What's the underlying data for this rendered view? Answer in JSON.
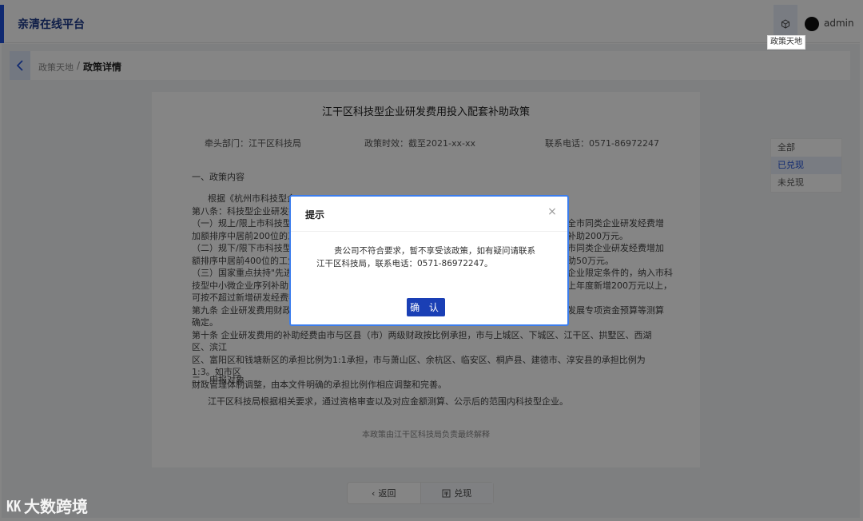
{
  "header": {
    "app_title": "亲清在线平台",
    "nav_tooltip": "政策天地",
    "username": "admin",
    "accent_color": "#1e4fd8"
  },
  "breadcrumb": {
    "parent": "政策天地",
    "separator": "/",
    "current": "政策详情"
  },
  "document": {
    "title": "江干区科技型企业研发费用投入配套补助政策",
    "meta": {
      "department": "牵头部门：江干区科技局",
      "validity": "政策时效：截至2021-xx-xx",
      "phone": "联系电话：0571-86972247"
    },
    "section1_title": "一、政策内容",
    "section1_lines": [
      "根据《杭州市科技型企",
      "第八条：科技型企业研发投",
      "（一）规上/限上市科技型",
      "加额排序中居前200位的工",
      "（二）规下/限下市科技型",
      "额排序中居前400位的工业",
      "（三）国家重点扶持\"先进",
      "技型中小微企业序列补助；",
      "可按不超过新增研发经费额",
      "第九条 企业研发费用财政补",
      "确定。",
      "第十条 企业研发费用的补助经费由市与区县（市）两级财政按比例承担，市与上城区、下城区、江干区、拱墅区、西湖区、滨江",
      "区、富阳区和钱塘新区的承担比例为1:1承担，市与萧山区、余杭区、临安区、桐庐县、建德市、淳安县的承担比例为1:3。如市区",
      "财政管理体制调整，由本文件明确的承担比例作相应调整和完善。"
    ],
    "right_fragments": [
      "全市同类企业研发经费增",
      "补助200万元。",
      "市同类企业研发经费增加",
      "助50万元。",
      "企业限定条件的，纳入市科",
      "上年度新增200万元以上，",
      "发展专项资金预算等测算"
    ],
    "section2_title": "二、申报对象",
    "section2_text": "江干区科技局根据相关要求，通过资格审查以及对应金额测算、公示后的范围内科技型企业。",
    "footer_note": "本政策由江干区科技局负责最终解释"
  },
  "filter": {
    "options": [
      "全部",
      "已兑现",
      "未兑现"
    ],
    "active_index": 1
  },
  "bottom_actions": {
    "back_label": "返回",
    "redeem_label": "兑现"
  },
  "dialog": {
    "title": "提示",
    "message_line1": "贵公司不符合要求，暂不享受该政策，如有疑问请联系",
    "message_line2": "江干区科技局，联系电话：0571-86972247。",
    "ok_label": "确 认",
    "border_color": "#3b7ded",
    "button_color": "#1a3fb5"
  },
  "watermark": {
    "logo_text": "㏍",
    "text": "大数跨境"
  }
}
